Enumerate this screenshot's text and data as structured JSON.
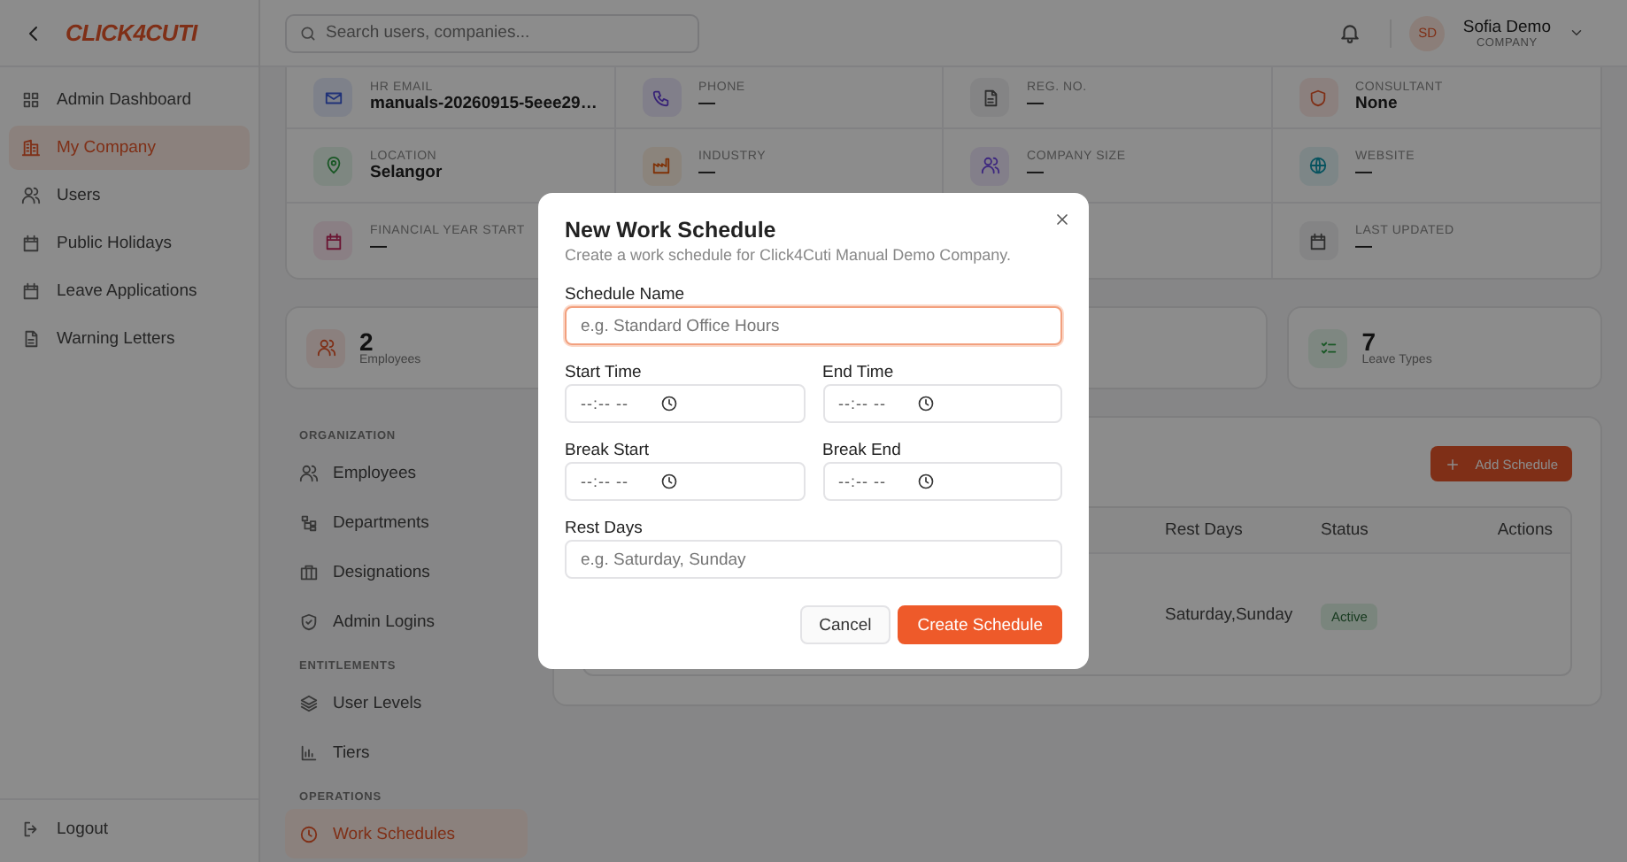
{
  "sidebar": {
    "logo": "CLICK4CUTI",
    "items": [
      {
        "label": "Admin Dashboard",
        "selected": false
      },
      {
        "label": "My Company",
        "selected": true
      },
      {
        "label": "Users",
        "selected": false
      },
      {
        "label": "Public Holidays",
        "selected": false
      },
      {
        "label": "Leave Applications",
        "selected": false
      },
      {
        "label": "Warning Letters",
        "selected": false
      }
    ],
    "logout": "Logout"
  },
  "topbar": {
    "search_placeholder": "Search users, companies...",
    "user": {
      "initials": "SD",
      "name": "Sofia Demo",
      "role": "COMPANY"
    }
  },
  "company_info": [
    {
      "label": "HR EMAIL",
      "value": "manuals-20260915-5eee29…"
    },
    {
      "label": "PHONE",
      "value": "—"
    },
    {
      "label": "REG. NO.",
      "value": "—"
    },
    {
      "label": "CONSULTANT",
      "value": "None"
    },
    {
      "label": "LOCATION",
      "value": "Selangor"
    },
    {
      "label": "INDUSTRY",
      "value": "—"
    },
    {
      "label": "COMPANY SIZE",
      "value": "—"
    },
    {
      "label": "WEBSITE",
      "value": "—"
    },
    {
      "label": "FINANCIAL YEAR START",
      "value": "—"
    },
    {
      "label": "LAST UPDATED",
      "value": "—"
    }
  ],
  "stats": [
    {
      "value": "2",
      "label": "Employees"
    },
    {
      "value": "7",
      "label": "Leave Types"
    }
  ],
  "subnav": [
    {
      "title": "ORGANIZATION",
      "items": [
        {
          "label": "Employees",
          "selected": false
        },
        {
          "label": "Departments",
          "selected": false
        },
        {
          "label": "Designations",
          "selected": false
        },
        {
          "label": "Admin Logins",
          "selected": false
        }
      ]
    },
    {
      "title": "ENTITLEMENTS",
      "items": [
        {
          "label": "User Levels",
          "selected": false
        },
        {
          "label": "Tiers",
          "selected": false
        }
      ]
    },
    {
      "title": "OPERATIONS",
      "items": [
        {
          "label": "Work Schedules",
          "selected": true
        }
      ]
    }
  ],
  "schedules": {
    "add_button": "Add Schedule",
    "columns": [
      "Rest Days",
      "Status",
      "Actions"
    ],
    "rows": [
      {
        "rest_days": "Saturday,Sunday",
        "status": "Active",
        "active": true
      }
    ]
  },
  "modal": {
    "title": "New Work Schedule",
    "subtitle": "Create a work schedule for Click4Cuti Manual Demo Company.",
    "fields": [
      {
        "label": "Schedule Name",
        "kind": "text",
        "placeholder": "e.g. Standard Office Hours",
        "focused": true
      },
      {
        "label": "Start Time",
        "kind": "time",
        "value": "--:-- --",
        "focused": false
      },
      {
        "label": "End Time",
        "kind": "time",
        "value": "--:-- --",
        "focused": false
      },
      {
        "label": "Break Start",
        "kind": "time",
        "value": "--:-- --",
        "focused": false
      },
      {
        "label": "Break End",
        "kind": "time",
        "value": "--:-- --",
        "focused": false
      },
      {
        "label": "Rest Days",
        "kind": "text",
        "placeholder": "e.g. Saturday, Sunday",
        "focused": false
      }
    ],
    "cancel": "Cancel",
    "submit": "Create Schedule"
  }
}
